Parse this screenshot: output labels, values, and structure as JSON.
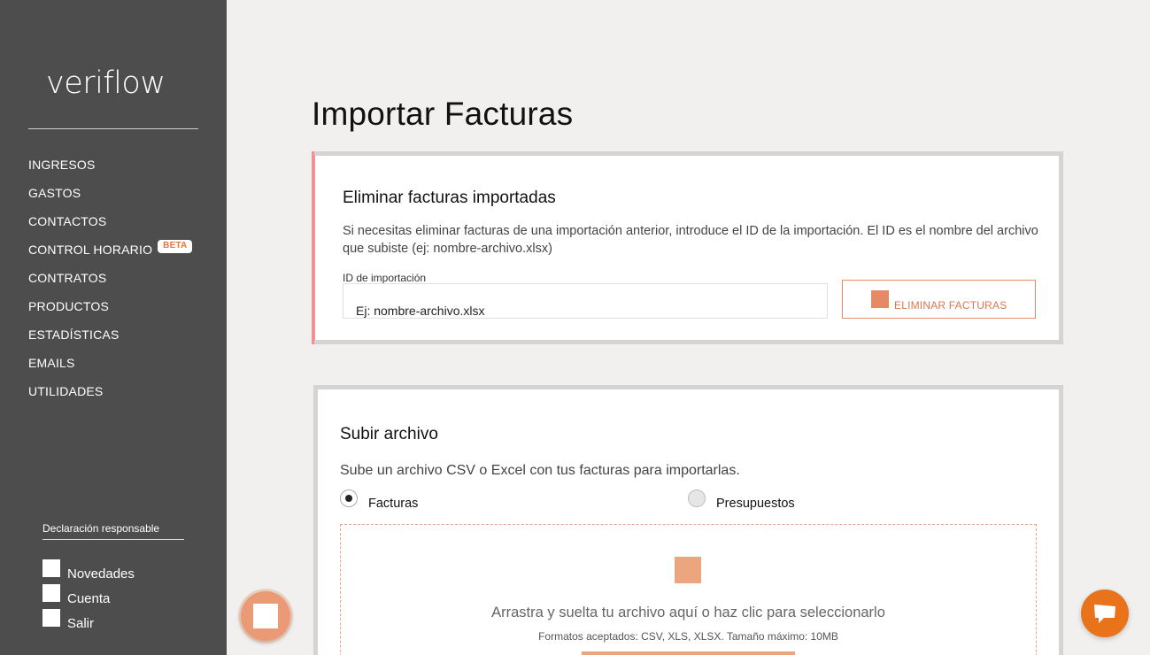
{
  "brand": {
    "logo_text": "veriflow"
  },
  "sidebar": {
    "items": [
      {
        "label": "INGRESOS"
      },
      {
        "label": "GASTOS"
      },
      {
        "label": "CONTACTOS"
      },
      {
        "label": "CONTROL HORARIO",
        "badge": "BETA"
      },
      {
        "label": "CONTRATOS"
      },
      {
        "label": "PRODUCTOS"
      },
      {
        "label": "ESTADÍSTICAS"
      },
      {
        "label": "EMAILS"
      },
      {
        "label": "UTILIDADES"
      }
    ],
    "declaration_link": "Declaración responsable",
    "bottom_links": [
      {
        "label": "Novedades",
        "icon": "square-icon"
      },
      {
        "label": "Cuenta",
        "icon": "square-icon"
      },
      {
        "label": "Salir",
        "icon": "square-icon"
      }
    ]
  },
  "main": {
    "title": "Importar Facturas",
    "delete_card": {
      "title": "Eliminar facturas importadas",
      "description": "Si necesitas eliminar facturas de una importación anterior, introduce el ID de la importación. El ID es el nombre del archivo que subiste (ej: nombre-archivo.xlsx)",
      "field_label": "ID de importación",
      "input_placeholder": "Ej: nombre-archivo.xlsx",
      "button_label": "ELIMINAR FACTURAS"
    },
    "upload_card": {
      "title": "Subir archivo",
      "description": "Sube un archivo CSV o Excel con tus facturas para importarlas.",
      "radio_options": [
        {
          "label": "Facturas",
          "checked": true
        },
        {
          "label": "Presupuestos",
          "checked": false
        }
      ],
      "dropzone_text": "Arrastra y suelta tu archivo aquí o haz clic para seleccionarlo",
      "dropzone_subtext": "Formatos aceptados: CSV, XLS, XLSX. Tamaño máximo: 10MB"
    }
  },
  "colors": {
    "sidebar_bg": "#4d4d4d",
    "accent": "#e58a65",
    "chat_button": "#e8731a",
    "page_bg": "#f1f0ee"
  }
}
